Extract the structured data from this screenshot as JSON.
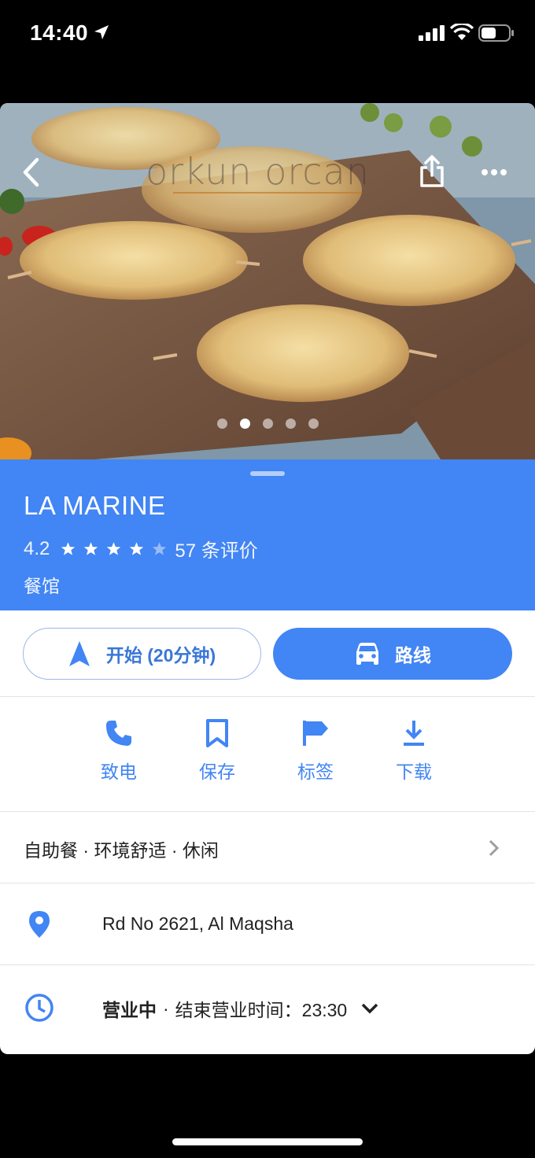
{
  "status_bar": {
    "time": "14:40"
  },
  "hero": {
    "watermark": "orkun orcan",
    "photo_count": 5,
    "active_photo_index": 1
  },
  "place": {
    "name": "LA MARINE",
    "rating": "4.2",
    "rating_value": 4.2,
    "reviews": "57 条评价",
    "category": "餐馆"
  },
  "buttons": {
    "start": "开始 (20分钟)",
    "route": "路线"
  },
  "quick_actions": [
    {
      "label": "致电",
      "icon": "phone-icon"
    },
    {
      "label": "保存",
      "icon": "bookmark-icon"
    },
    {
      "label": "标签",
      "icon": "flag-icon"
    },
    {
      "label": "下载",
      "icon": "download-icon"
    }
  ],
  "attributes": "自助餐 · 环境舒适 · 休闲",
  "address": "Rd No 2621, Al Maqsha",
  "hours": {
    "status": "营业中",
    "close_text": "结束营业时间：23:30"
  },
  "colors": {
    "accent": "#4285f4",
    "header_bg": "#4285f4",
    "text": "#222222"
  }
}
